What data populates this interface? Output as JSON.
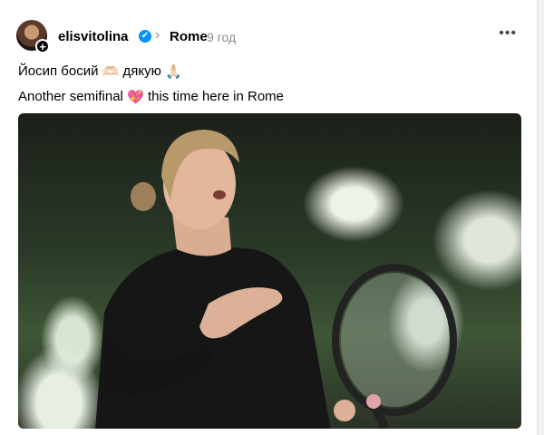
{
  "post": {
    "username": "elisvitolina",
    "verified_mark": "✔",
    "separator": "›",
    "location": "Rome",
    "time": "9 год",
    "more_icon": "•••",
    "avatar_plus": "+",
    "caption_line1": {
      "text_a": "Йосип босий",
      "emoji_a": "🫶🏻",
      "text_b": "дякую",
      "emoji_b": "🙏🏻"
    },
    "caption_line2": {
      "text_a": "Another semifinal",
      "emoji_a": "💖",
      "text_b": "this time here in Rome"
    }
  },
  "icons": [
    "avatar-plus-icon",
    "verified-badge-icon",
    "chevron-right-icon",
    "more-icon"
  ]
}
